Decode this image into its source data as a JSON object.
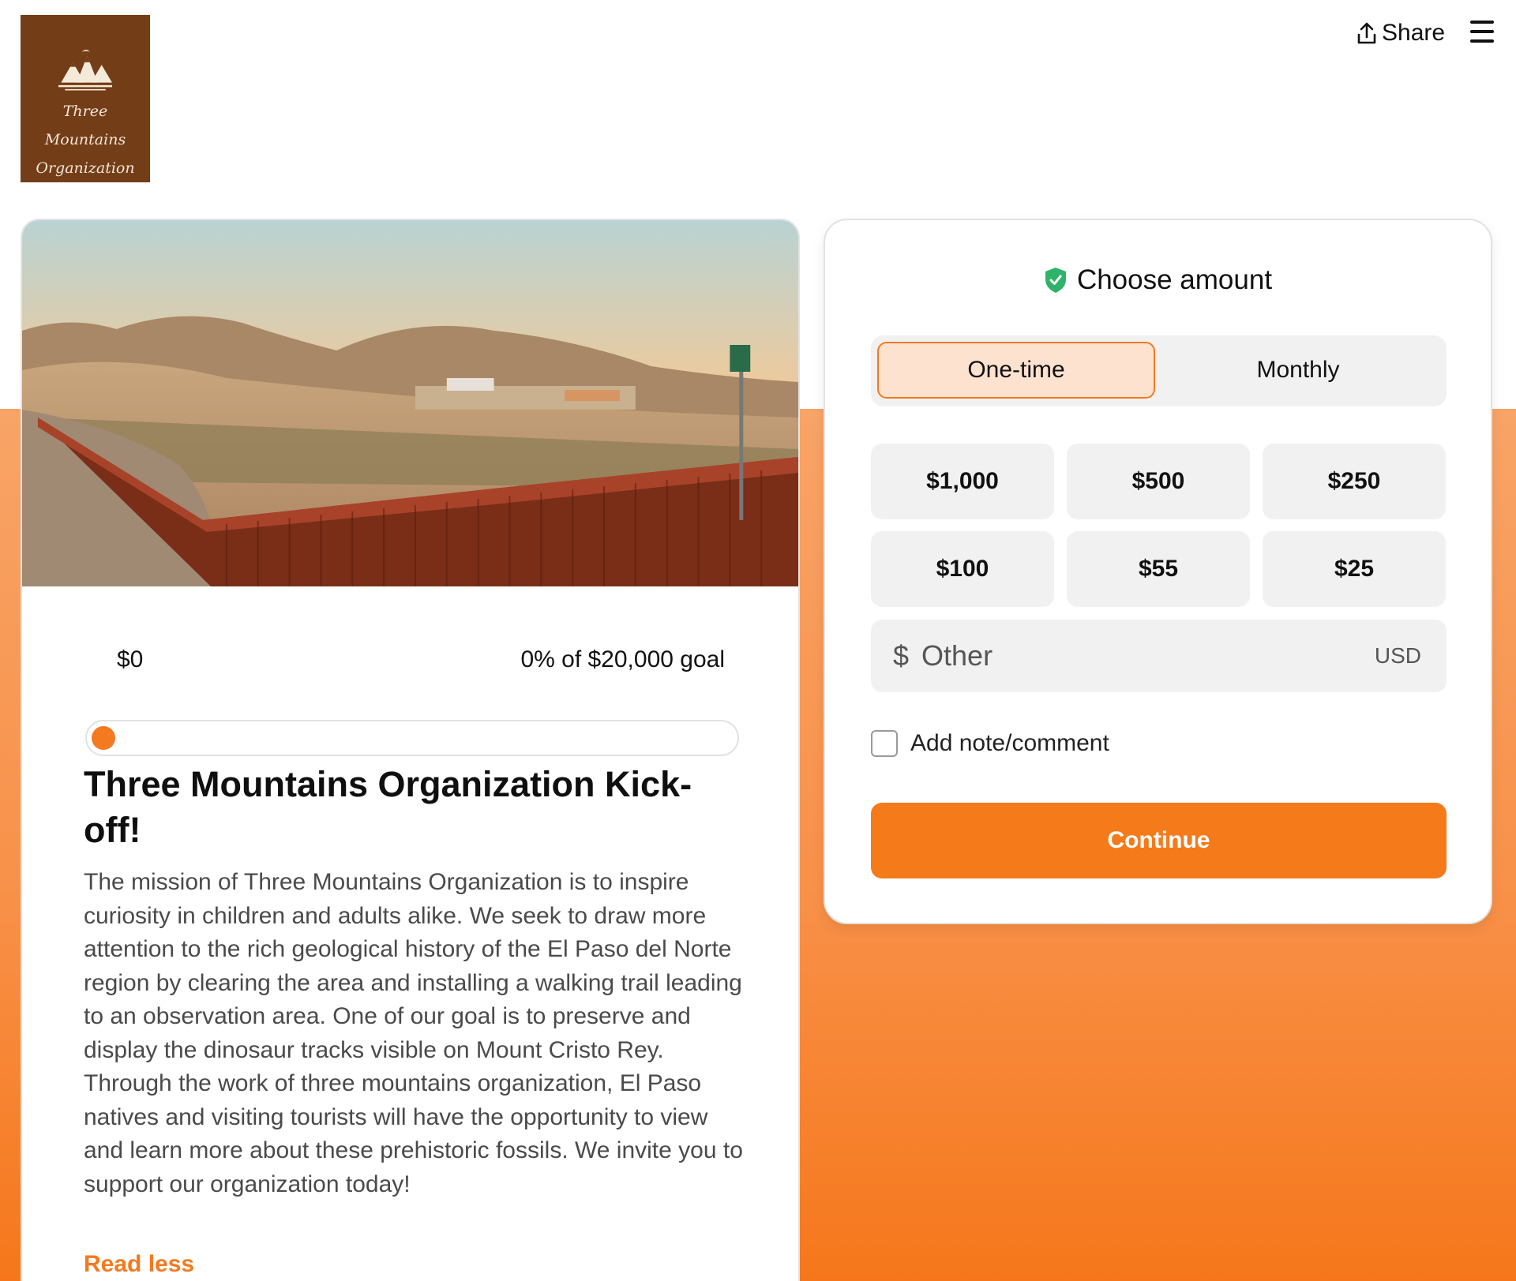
{
  "brand": {
    "logo_line1": "Three Mountains",
    "logo_line2": "Organization",
    "logo_bg": "#733d17"
  },
  "header": {
    "share_label": "Share",
    "share_icon": "share-upload-icon",
    "menu_icon": "hamburger-menu-icon"
  },
  "campaign": {
    "image_alt": "Desert mountains with rust-colored border fence at sunset",
    "raised": "$0",
    "goal_text": "0% of $20,000 goal",
    "progress_percent": 0,
    "title": "Three Mountains Organization Kick-off!",
    "description": "The mission of Three Mountains Organization is to inspire curiosity in children and adults alike. We seek to draw more attention to the rich geological history of the El Paso del Norte region by clearing the area and installing a walking trail leading to an observation area. One of our goal is to preserve and display the dinosaur tracks visible on Mount Cristo Rey. Through the work of three mountains organization, El Paso natives and visiting tourists will have the opportunity to view and learn more about these prehistoric fossils. We invite you to support our organization today!",
    "read_less": "Read less"
  },
  "donation": {
    "heading": "Choose amount",
    "heading_icon": "shield-check-icon",
    "frequency": {
      "one_time": "One-time",
      "monthly": "Monthly",
      "selected": "One-time"
    },
    "amounts": [
      "$1,000",
      "$500",
      "$250",
      "$100",
      "$55",
      "$25"
    ],
    "other": {
      "currency_symbol": "$",
      "placeholder": "Other",
      "currency_code": "USD"
    },
    "note_label": "Add note/comment",
    "note_checked": false,
    "continue_label": "Continue"
  },
  "colors": {
    "accent": "#f47a1f",
    "accent_light": "#fde2cf",
    "shield": "#2fb36a"
  }
}
